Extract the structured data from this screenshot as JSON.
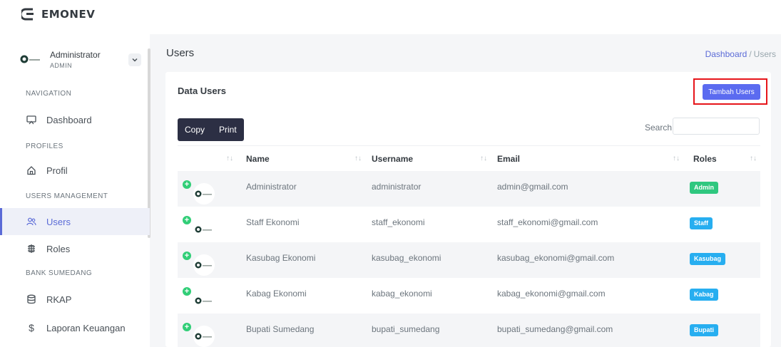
{
  "app": {
    "name": "EMONEV"
  },
  "user": {
    "name": "Administrator",
    "role": "ADMIN"
  },
  "nav": {
    "sections": [
      "NAVIGATION",
      "PROFILES",
      "USERS MANAGEMENT",
      "BANK SUMEDANG"
    ],
    "items": [
      {
        "label": "Dashboard",
        "icon": "monitor-icon"
      },
      {
        "label": "Profil",
        "icon": "home-icon"
      },
      {
        "label": "Users",
        "icon": "users-icon"
      },
      {
        "label": "Roles",
        "icon": "roles-icon"
      },
      {
        "label": "RKAP",
        "icon": "database-icon"
      },
      {
        "label": "Laporan Keuangan",
        "icon": "dollar-icon"
      }
    ],
    "active": "Users"
  },
  "page": {
    "title": "Users"
  },
  "breadcrumb": {
    "home": "Dashboard",
    "separator": "/",
    "current": "Users"
  },
  "card": {
    "title": "Data Users",
    "add_button": "Tambah Users"
  },
  "toolbar": {
    "copy": "Copy",
    "print": "Print",
    "search_label": "Search:",
    "search_value": ""
  },
  "table": {
    "columns": [
      "Name",
      "Username",
      "Email",
      "Roles"
    ],
    "rows": [
      {
        "name": "Administrator",
        "username": "administrator",
        "email": "admin@gmail.com",
        "role": "Admin",
        "role_color": "#2fc77f"
      },
      {
        "name": "Staff Ekonomi",
        "username": "staff_ekonomi",
        "email": "staff_ekonomi@gmail.com",
        "role": "Staff",
        "role_color": "#27aef0"
      },
      {
        "name": "Kasubag Ekonomi",
        "username": "kasubag_ekonomi",
        "email": "kasubag_ekonomi@gmail.com",
        "role": "Kasubag",
        "role_color": "#27aef0"
      },
      {
        "name": "Kabag Ekonomi",
        "username": "kabag_ekonomi",
        "email": "kabag_ekonomi@gmail.com",
        "role": "Kabag",
        "role_color": "#27aef0"
      },
      {
        "name": "Bupati Sumedang",
        "username": "bupati_sumedang",
        "email": "bupati_sumedang@gmail.com",
        "role": "Bupati",
        "role_color": "#27aef0"
      }
    ]
  },
  "colors": {
    "accent": "#5b6bf0",
    "highlight": "#e6151a",
    "dark_button": "#2c2f44"
  }
}
